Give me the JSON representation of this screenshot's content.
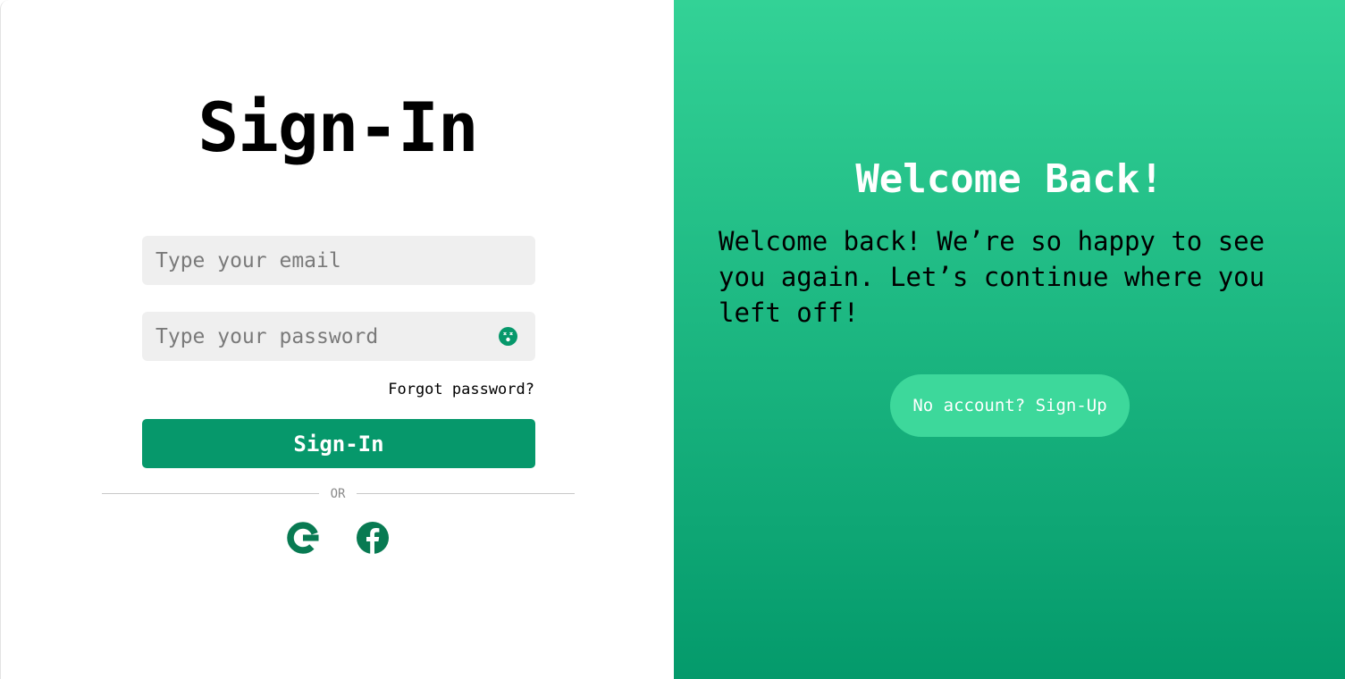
{
  "signin": {
    "title": "Sign-In",
    "email_placeholder": "Type your email",
    "password_placeholder": "Type your password",
    "password_toggle_icon": "eye-icon",
    "forgot_password": "Forgot password?",
    "submit_label": "Sign-In",
    "divider_text": "OR",
    "social": [
      {
        "name": "google",
        "icon": "google-icon"
      },
      {
        "name": "facebook",
        "icon": "facebook-icon"
      }
    ]
  },
  "welcome": {
    "title": "Welcome Back!",
    "message": "Welcome back! We’re so happy to see you again. Let’s continue where you left off!",
    "signup_label": "No account? Sign-Up"
  },
  "colors": {
    "accent": "#06986b",
    "panel_gradient_top": "#33d296",
    "panel_gradient_bottom": "#049a6b",
    "signup_button": "#3dd89b",
    "field_background": "#efefef"
  }
}
